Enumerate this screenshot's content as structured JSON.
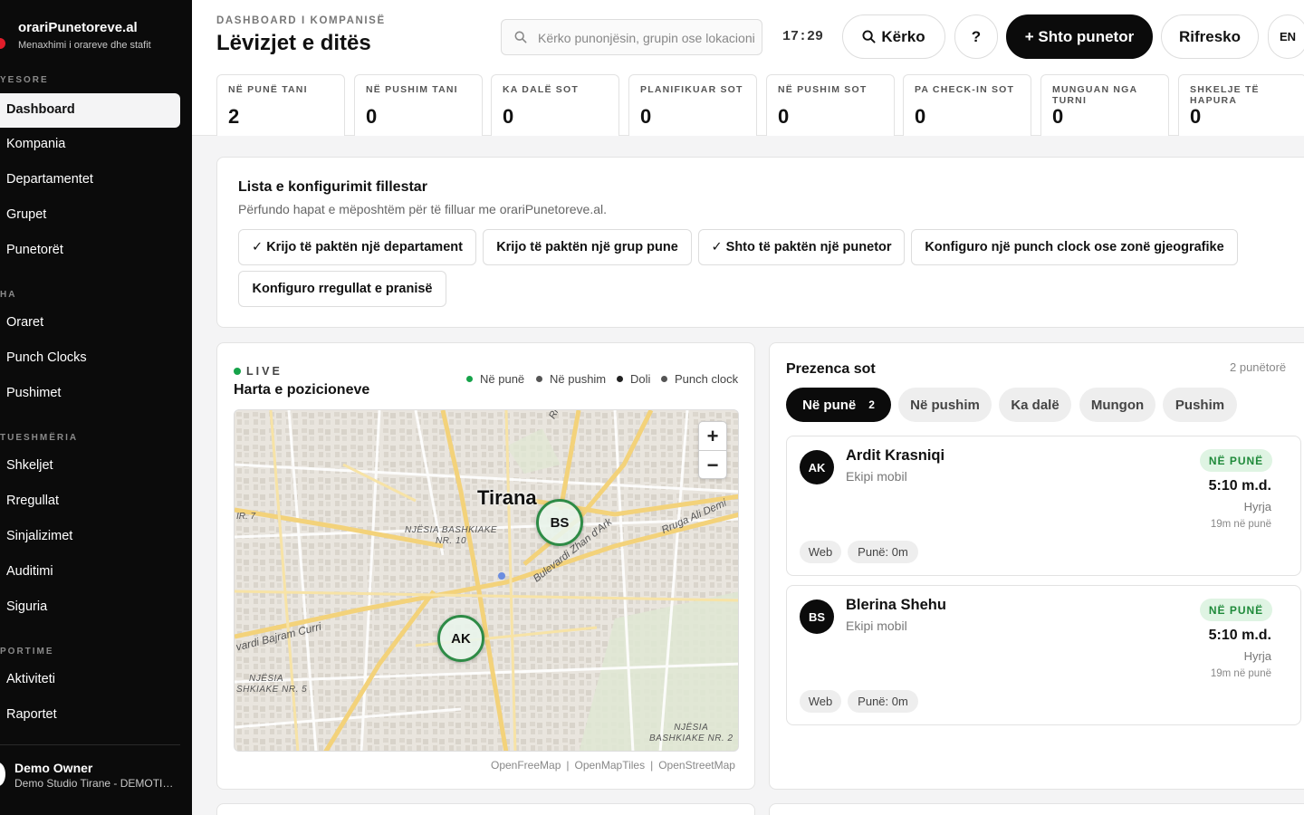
{
  "brand": {
    "title": "orariPunetoreve.al",
    "subtitle": "Menaxhimi i orareve dhe stafit"
  },
  "sidebar": {
    "sections": [
      {
        "label": "YESORE"
      },
      {
        "label": "HA"
      },
      {
        "label": "TUESHMËRIA"
      },
      {
        "label": "PORTIME"
      }
    ],
    "items": [
      {
        "label": "Dashboard",
        "active": true
      },
      {
        "label": "Kompania"
      },
      {
        "label": "Departamentet"
      },
      {
        "label": "Grupet"
      },
      {
        "label": "Punetorët"
      },
      {
        "label": "Oraret"
      },
      {
        "label": "Punch Clocks"
      },
      {
        "label": "Pushimet"
      },
      {
        "label": "Shkeljet"
      },
      {
        "label": "Rregullat"
      },
      {
        "label": "Sinjalizimet"
      },
      {
        "label": "Auditimi"
      },
      {
        "label": "Siguria"
      },
      {
        "label": "Aktiviteti"
      },
      {
        "label": "Raportet"
      }
    ],
    "user": {
      "name": "Demo Owner",
      "org": "Demo Studio Tirane - DEMOTIRANE"
    }
  },
  "header": {
    "breadcrumb": "DASHBOARD I KOMPANISË",
    "title": "Lëvizjet e ditës",
    "search_placeholder": "Kërko punonjësin, grupin ose lokacionin",
    "clock": "17:29",
    "buttons": {
      "search": "Kërko",
      "help": "?",
      "add": "+ Shto punetor",
      "refresh": "Rifresko",
      "lang": "EN"
    }
  },
  "stats": [
    {
      "label": "NË PUNË TANI",
      "value": "2"
    },
    {
      "label": "NË PUSHIM TANI",
      "value": "0"
    },
    {
      "label": "KA DALË SOT",
      "value": "0"
    },
    {
      "label": "PLANIFIKUAR SOT",
      "value": "0"
    },
    {
      "label": "NË PUSHIM SOT",
      "value": "0"
    },
    {
      "label": "PA CHECK-IN SOT",
      "value": "0"
    },
    {
      "label": "MUNGUAN NGA TURNI",
      "value": "0"
    },
    {
      "label": "SHKELJE TË HAPURA",
      "value": "0"
    }
  ],
  "checklist": {
    "title": "Lista e konfigurimit fillestar",
    "subtitle": "Përfundo hapat e mëposhtëm për të filluar me orariPunetoreve.al.",
    "items": [
      {
        "label": "✓ Krijo të paktën një departament",
        "done": true
      },
      {
        "label": "Krijo të paktën një grup pune",
        "done": false
      },
      {
        "label": "✓ Shto të paktën një punetor",
        "done": true
      },
      {
        "label": "Konfiguro një punch clock ose zonë gjeografike",
        "done": false
      },
      {
        "label": "Konfiguro rregullat e pranisë",
        "done": false
      }
    ]
  },
  "map": {
    "live_label": "LIVE",
    "title": "Harta e pozicioneve",
    "legend": [
      {
        "label": "Në punë",
        "color": "#16a34a"
      },
      {
        "label": "Në pushim",
        "color": "#555555"
      },
      {
        "label": "Doli",
        "color": "#222222"
      },
      {
        "label": "Punch clock",
        "color": "#555555"
      }
    ],
    "city": "Tirana",
    "street_labels": {
      "rruga_e": "Rruga e",
      "zhan_dark": "Bulevardi Zhan d'Ark",
      "rruga_ali": "Rruga Ali Demi",
      "bajram": "vardi Bajram Curri",
      "nr7": "IR. 7",
      "njesia10_a": "NJËSIA BASHKIAKE",
      "njesia10_b": "NR. 10",
      "njesia5_a": "NJËSIA",
      "njesia5_b": "SHKIAKE NR. 5",
      "njesia2_a": "NJËSIA",
      "njesia2_b": "BASHKIAKE NR. 2"
    },
    "markers": [
      {
        "initials": "BS"
      },
      {
        "initials": "AK"
      }
    ],
    "zoom_in": "+",
    "zoom_out": "−",
    "attribution": [
      "OpenFreeMap",
      "OpenMapTiles",
      "OpenStreetMap"
    ]
  },
  "presence": {
    "title": "Prezenca sot",
    "count": "2 punëtorë",
    "tabs": [
      {
        "label": "Në punë",
        "count": "2",
        "active": true
      },
      {
        "label": "Në pushim"
      },
      {
        "label": "Ka dalë"
      },
      {
        "label": "Mungon"
      },
      {
        "label": "Pushim"
      }
    ],
    "people": [
      {
        "initials": "AK",
        "name": "Ardit Krasniqi",
        "team": "Ekipi mobil",
        "status": "NË PUNË",
        "time": "5:10 m.d.",
        "event": "Hyrja",
        "duration": "19m në punë",
        "source": "Web",
        "worked": "Punë: 0m"
      },
      {
        "initials": "BS",
        "name": "Blerina Shehu",
        "team": "Ekipi mobil",
        "status": "NË PUNË",
        "time": "5:10 m.d.",
        "event": "Hyrja",
        "duration": "19m në punë",
        "source": "Web",
        "worked": "Punë: 0m"
      }
    ]
  }
}
